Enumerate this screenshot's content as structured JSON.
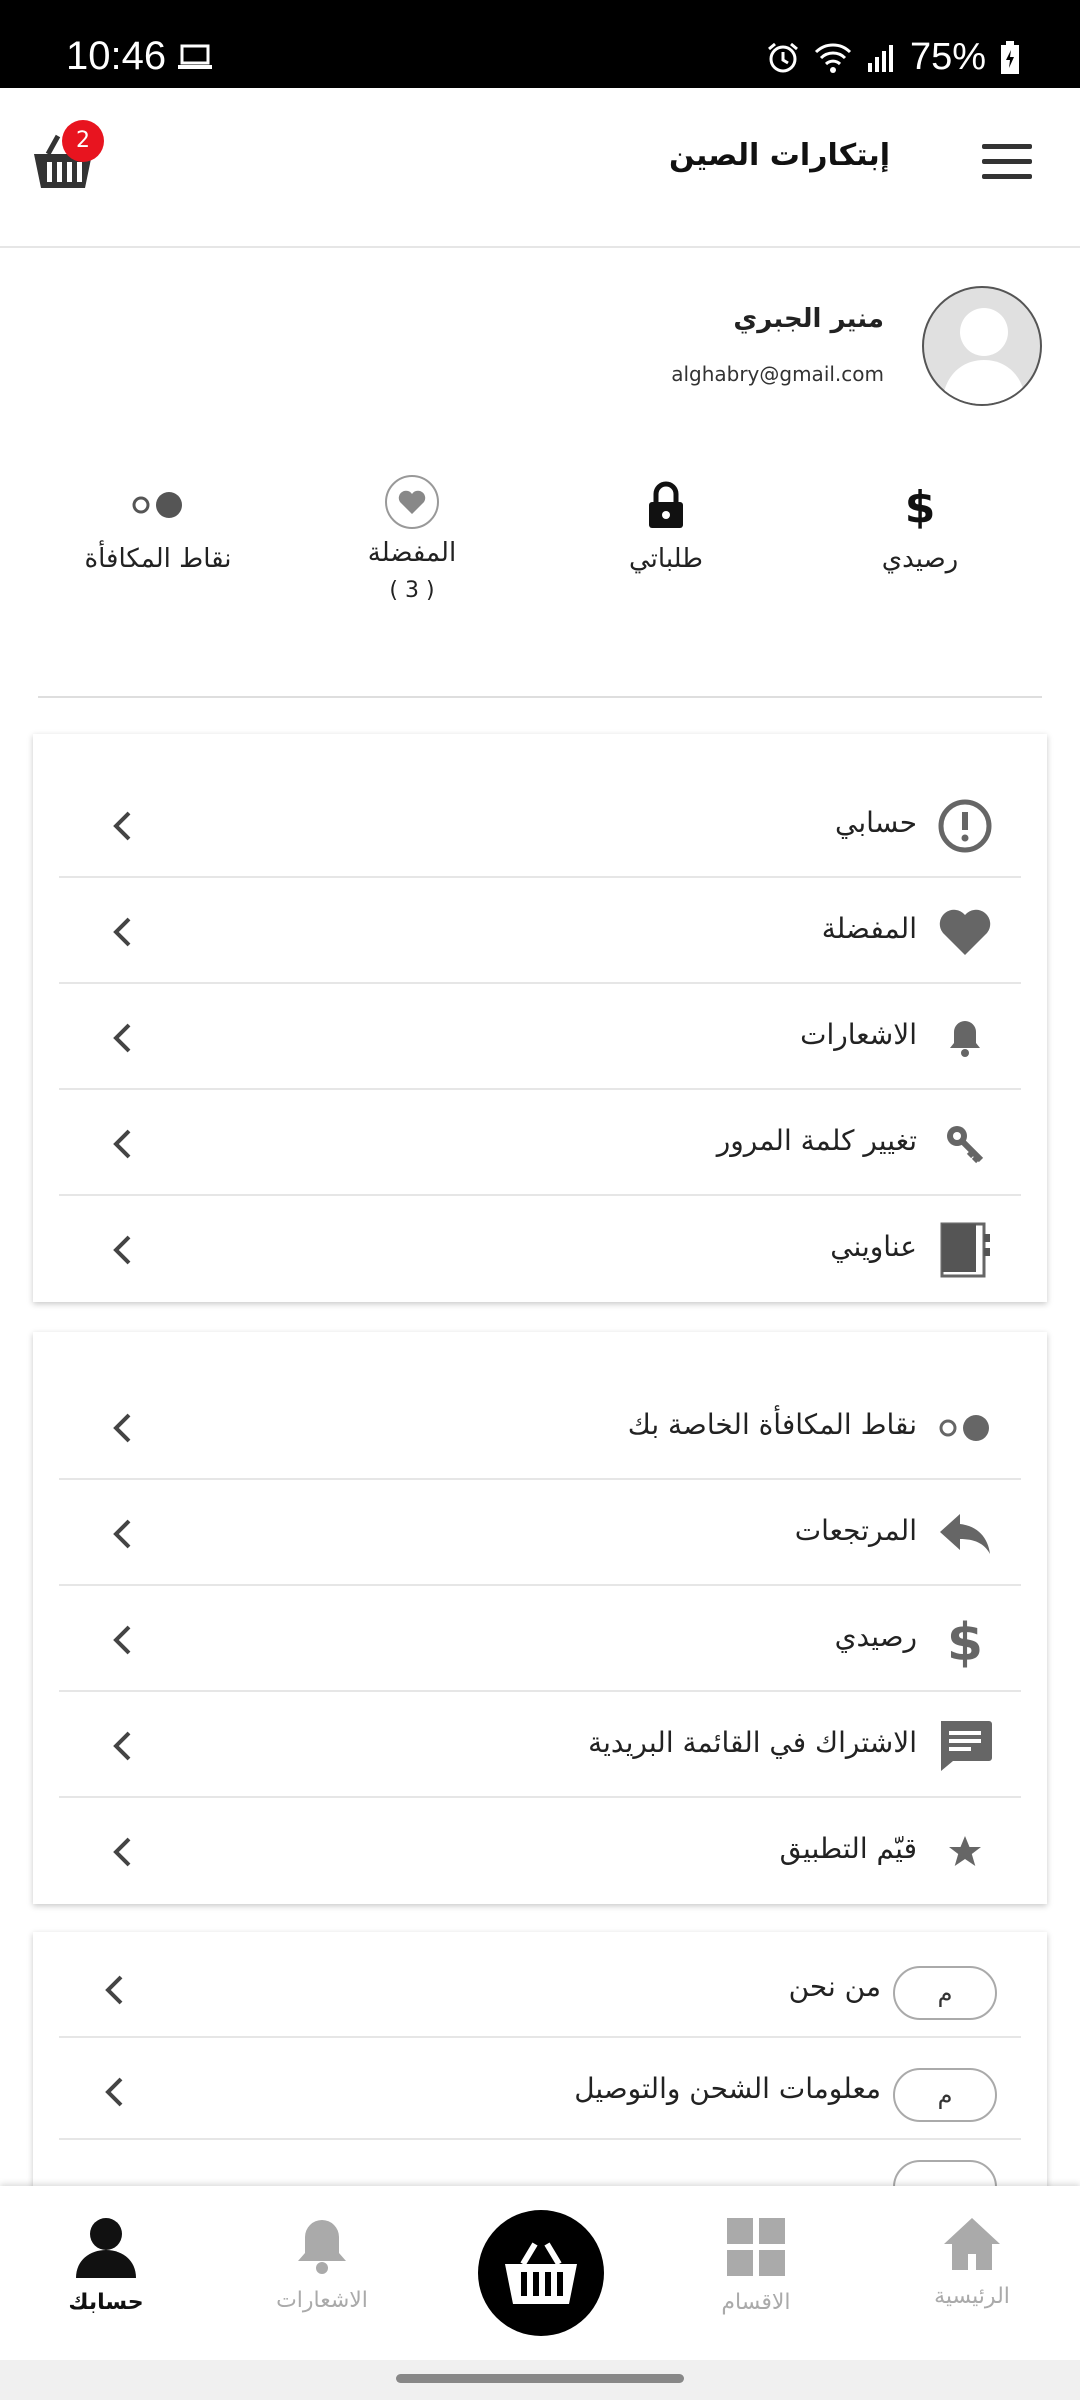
{
  "status_bar": {
    "time": "10:46",
    "battery": "75%"
  },
  "header": {
    "title": "إبتكارات الصين",
    "cart_count": "2"
  },
  "profile": {
    "name": "منير الجبري",
    "email": "alghabry@gmail.com"
  },
  "stats": [
    {
      "label": "رصيدي",
      "icon": "dollar-icon"
    },
    {
      "label": "طلباتي",
      "icon": "lock-icon"
    },
    {
      "label": "المفضلة",
      "count": "( 3 )",
      "icon": "heart-circle-icon"
    },
    {
      "label": "نقاط المكافأة",
      "icon": "points-icon"
    }
  ],
  "account_menu": [
    {
      "label": "حسابي",
      "icon": "info-circle-icon"
    },
    {
      "label": "المفضلة",
      "icon": "heart-icon"
    },
    {
      "label": "الاشعارات",
      "icon": "bell-icon"
    },
    {
      "label": "تغيير كلمة المرور",
      "icon": "key-icon"
    },
    {
      "label": "عناويني",
      "icon": "address-book-icon"
    }
  ],
  "extra_menu": [
    {
      "label": "نقاط المكافأة الخاصة بك",
      "icon": "points-icon"
    },
    {
      "label": "المرتجعات",
      "icon": "reply-icon"
    },
    {
      "label": "رصيدي",
      "icon": "dollar-icon"
    },
    {
      "label": "الاشتراك في القائمة البريدية",
      "icon": "message-icon"
    },
    {
      "label": "قيّم التطبيق",
      "icon": "star-icon"
    }
  ],
  "pages_menu": [
    {
      "label": "من نحن",
      "pill": "م"
    },
    {
      "label": "معلومات الشحن والتوصيل",
      "pill": "م"
    }
  ],
  "bottom_nav": [
    {
      "label": "الرئيسية",
      "icon": "home-icon"
    },
    {
      "label": "الاقسام",
      "icon": "grid-icon"
    },
    {
      "label": "الاشعارات",
      "icon": "bell-icon"
    },
    {
      "label": "حسابك",
      "icon": "user-icon"
    }
  ],
  "colors": {
    "badge": "#e8141f",
    "icon_gray": "#666666",
    "nav_inactive": "#aaaaaa"
  }
}
